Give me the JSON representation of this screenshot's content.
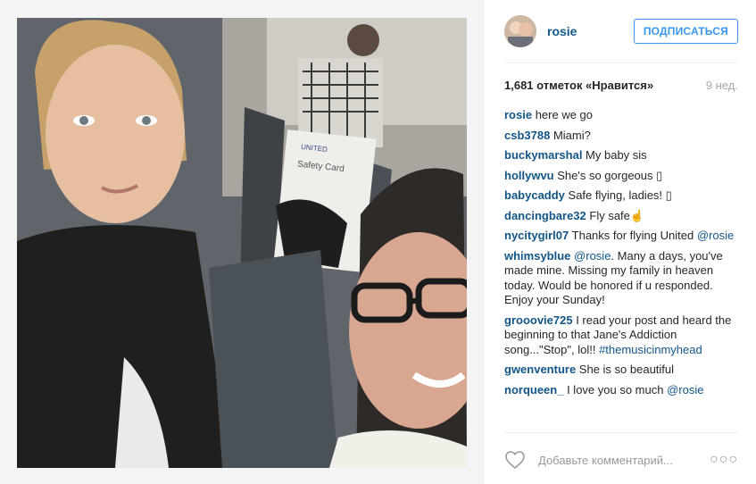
{
  "post": {
    "username": "rosie",
    "follow_label": "ПОДПИСАТЬСЯ",
    "likes": "1,681 отметок «Нравится»",
    "age": "9 нед.",
    "photo_text": {
      "airline": "UNITED",
      "card": "Safety Card"
    }
  },
  "comments": [
    {
      "user": "rosie",
      "text": " here we go"
    },
    {
      "user": "csb3788",
      "text": " Miami?"
    },
    {
      "user": "buckymarshal",
      "text": " My baby sis"
    },
    {
      "user": "hollywvu",
      "text": " She's so gorgeous ▯"
    },
    {
      "user": "babycaddy",
      "text": " Safe flying, ladies! ▯"
    },
    {
      "user": "dancingbare32",
      "text": " Fly safe☝"
    },
    {
      "user": "nycitygirl07",
      "text": " Thanks for flying United ",
      "mention": "@rosie"
    },
    {
      "user": "whimsyblue",
      "mention_first": "@rosie",
      "text": ". Many a days, you've made mine. Missing my family in heaven today. Would be honored if u responded. Enjoy your Sunday!"
    },
    {
      "user": "grooovie725",
      "text": " I read your post and heard the beginning to that Jane's Addiction song...\"Stop\", lol!! ",
      "mention": "#themusicinmyhead"
    },
    {
      "user": "gwenventure",
      "text": " She is so beautiful"
    },
    {
      "user": "norqueen_",
      "text": " I love you so much ",
      "mention": "@rosie"
    }
  ],
  "footer": {
    "placeholder": "Добавьте комментарий...",
    "more": "○○○"
  },
  "icons": [
    "heart-icon",
    "more-options-icon"
  ]
}
